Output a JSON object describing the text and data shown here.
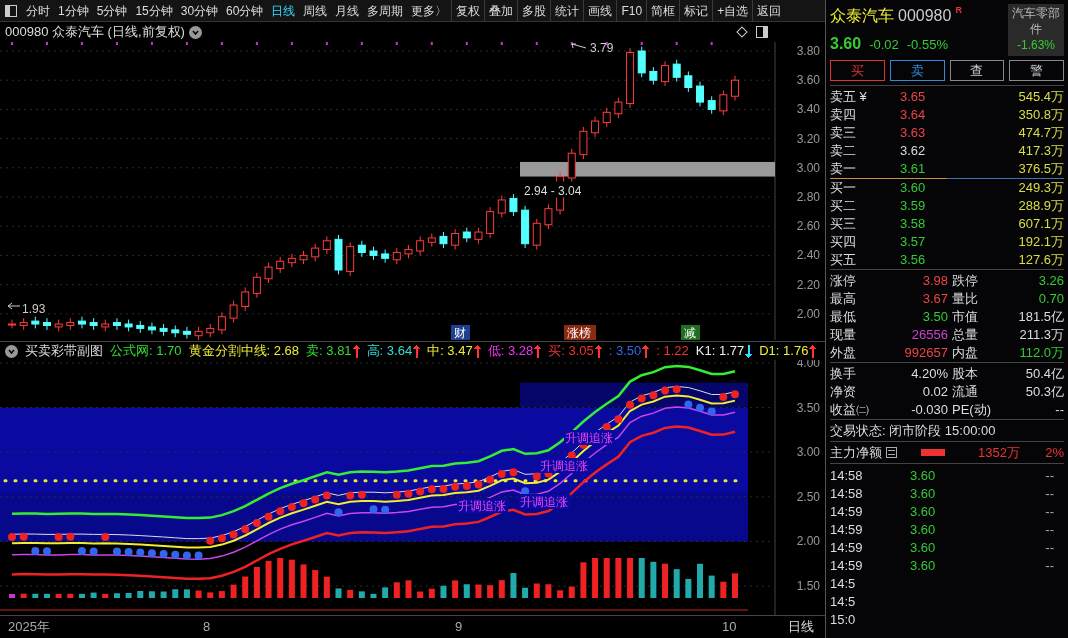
{
  "toolbar": {
    "periods": [
      {
        "label": "分时",
        "selected": false
      },
      {
        "label": "1分钟",
        "selected": false
      },
      {
        "label": "5分钟",
        "selected": false
      },
      {
        "label": "15分钟",
        "selected": false
      },
      {
        "label": "30分钟",
        "selected": false
      },
      {
        "label": "60分钟",
        "selected": false
      },
      {
        "label": "日线",
        "selected": true
      },
      {
        "label": "周线",
        "selected": false
      },
      {
        "label": "月线",
        "selected": false
      },
      {
        "label": "多周期",
        "selected": false
      },
      {
        "label": "更多〉",
        "selected": false
      }
    ],
    "buttons": [
      "复权",
      "叠加",
      "多股",
      "统计",
      "画线",
      "F10",
      "简框",
      "标记",
      "+自选",
      "返回"
    ]
  },
  "main_chart": {
    "title": "000980 众泰汽车 (日线,前复权)",
    "axis_labels": [
      "3.80",
      "3.60",
      "3.40",
      "3.20",
      "3.00",
      "2.80",
      "2.60",
      "2.40",
      "2.20",
      "2.00"
    ],
    "high_label": "3.79",
    "low_label": "1.93",
    "zone_label": "2.94 - 3.04",
    "events": [
      {
        "label": "财",
        "color": "#1f3f8f"
      },
      {
        "label": "涨榜",
        "color": "#8a2a10"
      },
      {
        "label": "减",
        "color": "#1f6f1f"
      }
    ]
  },
  "indicator": {
    "name": "买卖彩带副图",
    "readings": [
      {
        "label": "公式网: 1.70",
        "color": "#33dd33"
      },
      {
        "label": "黄金分割中线: 2.68",
        "color": "#eeee33"
      },
      {
        "label": "卖: 3.81",
        "color": "#33dd33",
        "arrow": {
          "rising": true,
          "color": "#ff3333"
        }
      },
      {
        "label": "高: 3.64",
        "color": "#33dddd",
        "arrow": {
          "rising": true,
          "color": "#ff3333"
        }
      },
      {
        "label": "中: 3.47",
        "color": "#eeee33",
        "arrow": {
          "rising": true,
          "color": "#ff3333"
        }
      },
      {
        "label": "低: 3.28",
        "color": "#ee33ee",
        "arrow": {
          "rising": true,
          "color": "#ff3333"
        }
      },
      {
        "label": "买: 3.05",
        "color": "#ee3333",
        "arrow": {
          "rising": true,
          "color": "#ff3333"
        }
      },
      {
        "label": ": 3.50",
        "color": "#3366ee",
        "arrow": {
          "rising": true,
          "color": "#ff3333"
        }
      },
      {
        "label": ": 1.22",
        "color": "#ee3333"
      },
      {
        "label": "K1: 1.77",
        "color": "#eeeeee",
        "arrow": {
          "rising": false,
          "color": "#33ddff"
        }
      },
      {
        "label": "D1: 1.76",
        "color": "#eeee33",
        "arrow": {
          "rising": true,
          "color": "#ff3333"
        }
      }
    ],
    "axis_labels": [
      "4.00",
      "3.50",
      "3.00",
      "2.50",
      "2.00",
      "1.50"
    ],
    "annotations": [
      "升调追涨",
      "升调追涨",
      "升调追涨",
      "升调追涨"
    ]
  },
  "date_axis": {
    "labels": [
      "2025年",
      "8",
      "9",
      "10"
    ],
    "period": "日线"
  },
  "quote": {
    "name": "众泰汽车",
    "code": "000980",
    "badge": "R",
    "price": "3.60",
    "change": "-0.02",
    "change_pct": "-0.55%",
    "sector": "汽车零部件",
    "sector_change": "-1.63%",
    "actions": [
      {
        "label": "买",
        "color": "#dd3333"
      },
      {
        "label": "卖",
        "color": "#3388dd"
      },
      {
        "label": "查",
        "color": "#888888"
      },
      {
        "label": "警",
        "color": "#888888"
      }
    ]
  },
  "order_book": {
    "asks": [
      {
        "label": "卖五 ¥",
        "price": "3.65",
        "color": "#ee4444",
        "volume": "545.4万"
      },
      {
        "label": "卖四",
        "price": "3.64",
        "color": "#ee4444",
        "volume": "350.8万"
      },
      {
        "label": "卖三",
        "price": "3.63",
        "color": "#ee4444",
        "volume": "474.7万"
      },
      {
        "label": "卖二",
        "price": "3.62",
        "color": "#dddddd",
        "volume": "417.3万"
      },
      {
        "label": "卖一",
        "price": "3.61",
        "color": "#33cc33",
        "volume": "376.5万"
      }
    ],
    "bids": [
      {
        "label": "买一",
        "price": "3.60",
        "color": "#33cc33",
        "volume": "249.3万"
      },
      {
        "label": "买二",
        "price": "3.59",
        "color": "#33cc33",
        "volume": "288.9万"
      },
      {
        "label": "买三",
        "price": "3.58",
        "color": "#33cc33",
        "volume": "607.1万"
      },
      {
        "label": "买四",
        "price": "3.57",
        "color": "#33cc33",
        "volume": "192.1万"
      },
      {
        "label": "买五",
        "price": "3.56",
        "color": "#33cc33",
        "volume": "127.6万"
      }
    ]
  },
  "stats": [
    [
      {
        "label": "涨停",
        "value": "3.98",
        "color": "#ee4444"
      },
      {
        "label": "跌停",
        "value": "3.26",
        "color": "#33cc33"
      }
    ],
    [
      {
        "label": "最高",
        "value": "3.67",
        "color": "#ee4444"
      },
      {
        "label": "量比",
        "value": "0.70",
        "color": "#33cc33"
      }
    ],
    [
      {
        "label": "最低",
        "value": "3.50",
        "color": "#33cc33"
      },
      {
        "label": "市值",
        "value": "181.5亿",
        "color": "#dddddd"
      }
    ],
    [
      {
        "label": "现量",
        "value": "26556",
        "color": "#cc44cc"
      },
      {
        "label": "总量",
        "value": "211.3万",
        "color": "#dddddd"
      }
    ],
    [
      {
        "label": "外盘",
        "value": "992657",
        "color": "#ee4444"
      },
      {
        "label": "内盘",
        "value": "112.0万",
        "color": "#33cc33"
      }
    ]
  ],
  "fundamentals": [
    [
      {
        "label": "换手",
        "value": "4.20%"
      },
      {
        "label": "股本",
        "value": "50.4亿"
      }
    ],
    [
      {
        "label": "净资",
        "value": "0.02"
      },
      {
        "label": "流通",
        "value": "50.3亿"
      }
    ],
    [
      {
        "label": "收益㈡",
        "value": "-0.030"
      },
      {
        "label": "PE(动)",
        "value": "--"
      }
    ]
  ],
  "trade_status": "交易状态: 闭市阶段 15:00:00",
  "main_flow": {
    "label": "主力净额",
    "amount": "1352万",
    "pct": "2%"
  },
  "ticks": [
    {
      "time": "14:58",
      "price": "3.60",
      "volume": "--"
    },
    {
      "time": "14:58",
      "price": "3.60",
      "volume": "--"
    },
    {
      "time": "14:59",
      "price": "3.60",
      "volume": "--"
    },
    {
      "time": "14:59",
      "price": "3.60",
      "volume": "--"
    },
    {
      "time": "14:59",
      "price": "3.60",
      "volume": "--"
    },
    {
      "time": "14:59",
      "price": "3.60",
      "volume": "--"
    },
    {
      "time": "14:5"
    },
    {
      "time": "14:5"
    },
    {
      "time": "15:0"
    }
  ]
}
